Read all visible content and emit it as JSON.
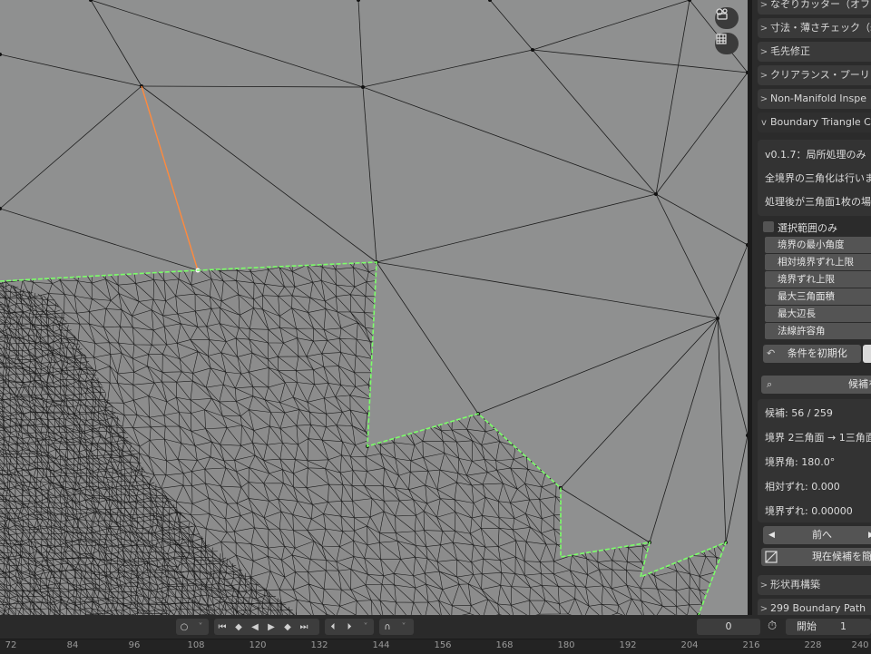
{
  "panel": {
    "sections_top": [
      {
        "label": "なぞりカッター（オフ"
      },
      {
        "label": "寸法・薄さチェック（s"
      },
      {
        "label": "毛先修正"
      },
      {
        "label": "クリアランス・プーリ"
      },
      {
        "label": "Non-Manifold Inspe"
      }
    ],
    "active_section": {
      "label": "Boundary Triangle Cl"
    },
    "info_lines": [
      "v0.1.7：局所処理のみ",
      "全境界の三角化は行いま",
      "処理後が三角面1枚の場所"
    ],
    "selection_only": {
      "label": "選択範囲のみ",
      "checked": false
    },
    "props": [
      "境界の最小角度",
      "相対境界ずれ上限",
      "境界ずれ上限",
      "最大三角面積",
      "最大辺長",
      "法線許容角"
    ],
    "reset_button": "条件を初期化",
    "search_button": "候補を",
    "candidate_info": [
      "候補: 56 / 259",
      "境界 2三角面 → 1三角面",
      "境界角: 180.0°",
      "相対ずれ: 0.000",
      "境界ずれ: 0.00000"
    ],
    "prev_button": "前へ",
    "simplify_button": "現在候補を簡",
    "sections_bottom": [
      {
        "label": "形状再構築"
      },
      {
        "label": "299 Boundary Path"
      }
    ]
  },
  "timeline": {
    "current_frame": "0",
    "start_label": "開始",
    "start_value": "1",
    "ruler_ticks": [
      "72",
      "84",
      "96",
      "108",
      "120",
      "132",
      "144",
      "156",
      "168",
      "180",
      "192",
      "204",
      "216",
      "228",
      "240"
    ]
  },
  "colors": {
    "viewport_bg": "#8f9090",
    "boundary_edge": "#7cff6a",
    "selected_edge": "#ff8a3d",
    "panel_bg": "#2b2b2b"
  }
}
